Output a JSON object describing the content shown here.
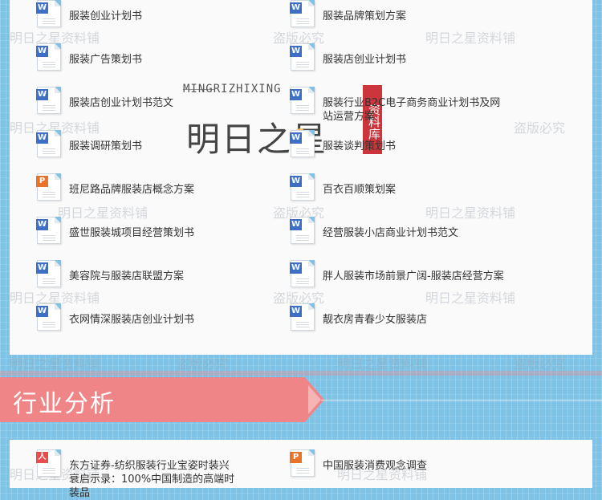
{
  "files": [
    {
      "type": "w",
      "label": "服装创业计划书"
    },
    {
      "type": "w",
      "label": "服装品牌策划方案"
    },
    {
      "type": "w",
      "label": "服装广告策划书"
    },
    {
      "type": "w",
      "label": "服装店创业计划书"
    },
    {
      "type": "w",
      "label": "服装店创业计划书范文"
    },
    {
      "type": "w",
      "label": "服装行业B2C电子商务商业计划书及网站运营方案"
    },
    {
      "type": "w",
      "label": "服装调研策划书"
    },
    {
      "type": "w",
      "label": "服装谈判策划书"
    },
    {
      "type": "p",
      "label": "班尼路品牌服装店概念方案"
    },
    {
      "type": "w",
      "label": "百衣百顺策划案"
    },
    {
      "type": "w",
      "label": "盛世服装城项目经营策划书"
    },
    {
      "type": "w",
      "label": "经营服装小店商业计划书范文"
    },
    {
      "type": "w",
      "label": "美容院与服装店联盟方案"
    },
    {
      "type": "w",
      "label": "胖人服装市场前景广阔-服装店经营方案"
    },
    {
      "type": "w",
      "label": "衣网情深服装店创业计划书"
    },
    {
      "type": "w",
      "label": "靓衣房青春少女服装店"
    }
  ],
  "bottom_files": [
    {
      "type": "pdf",
      "label": "东方证券-纺织服装行业宝姿时装兴衰启示录：100%中国制造的高端时装品"
    },
    {
      "type": "p",
      "label": "中国服装消费观念调查"
    }
  ],
  "section": {
    "title": "行业分析"
  },
  "logo": {
    "en": "MINGRIZHIXING",
    "cn": "明日之星",
    "seal": "资料库"
  },
  "watermark": {
    "brand": "明日之星资料铺",
    "piracy": "盗版必究"
  },
  "colors": {
    "background": "#7ec3e6",
    "section": "#f08587",
    "word": "#3e6fc6",
    "ppt": "#e8742c",
    "pdf": "#e94c4c"
  },
  "icons": {
    "w": "word-doc-icon",
    "p": "ppt-doc-icon",
    "pdf": "pdf-doc-icon"
  },
  "badges": {
    "w": "W",
    "p": "P",
    "pdf": "人"
  }
}
